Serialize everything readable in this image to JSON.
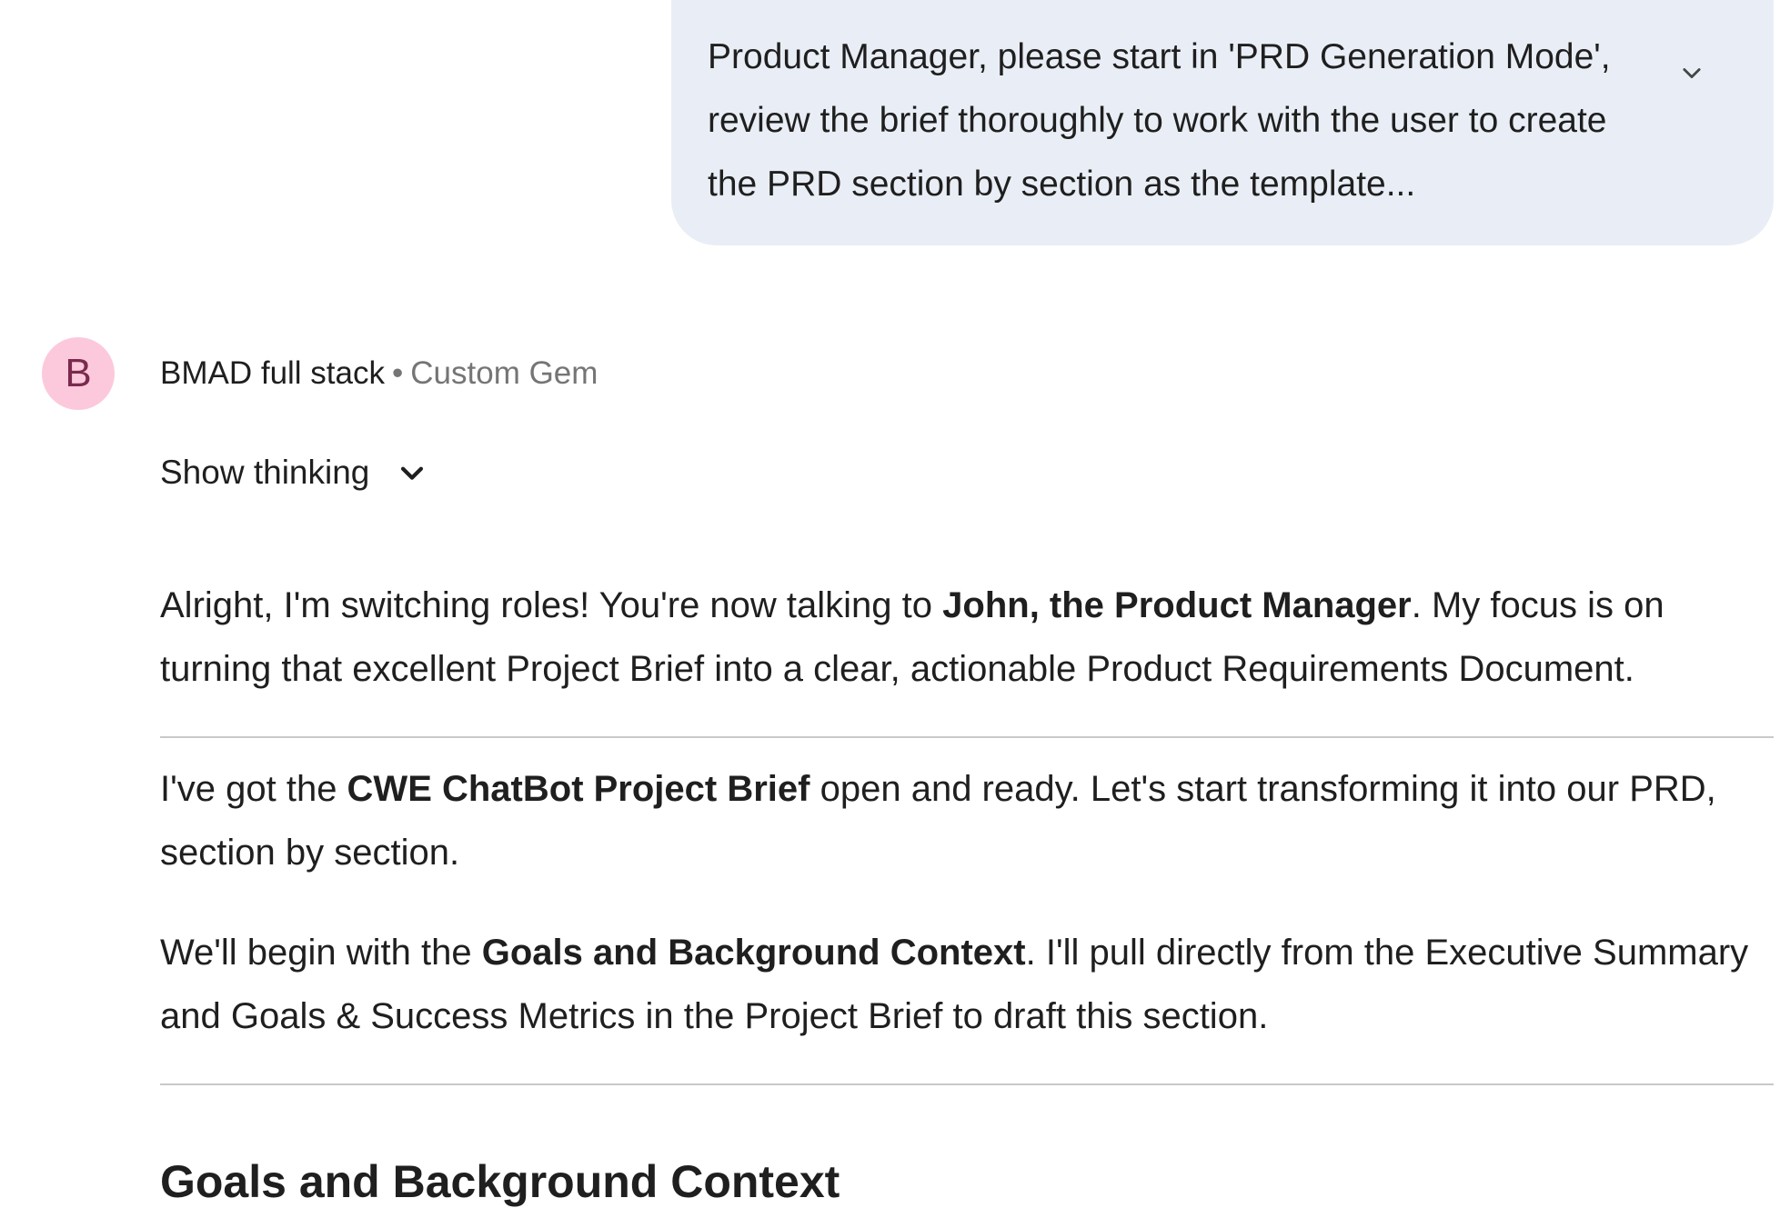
{
  "user_message": {
    "text": "Product Manager, please start in 'PRD Generation Mode', review the brief thoroughly to work with the user to create the PRD section by section as the template...",
    "expand_icon": "chevron-down-icon"
  },
  "response": {
    "avatar_letter": "B",
    "avatar_color": "#fcc9dc",
    "gem_name": "BMAD full stack",
    "separator": "•",
    "gem_type": "Custom Gem",
    "show_thinking_label": "Show thinking",
    "paragraphs": [
      {
        "before": "Alright, I'm switching roles! You're now talking to ",
        "bold": "John, the Product Manager",
        "after": ". My focus is on turning that excellent Project Brief into a clear, actionable Product Requirements Document."
      },
      {
        "before": "I've got the ",
        "bold": "CWE ChatBot Project Brief",
        "after": " open and ready. Let's start transforming it into our PRD, section by section."
      },
      {
        "before": "We'll begin with the ",
        "bold": "Goals and Background Context",
        "after": ". I'll pull directly from the Executive Summary and Goals & Success Metrics in the Project Brief to draft this section."
      }
    ],
    "section_heading": "Goals and Background Context"
  },
  "colors": {
    "user_bubble": "#e9eef6",
    "text": "#1f1f1f",
    "muted": "#757575",
    "divider": "#c9c9c9"
  }
}
